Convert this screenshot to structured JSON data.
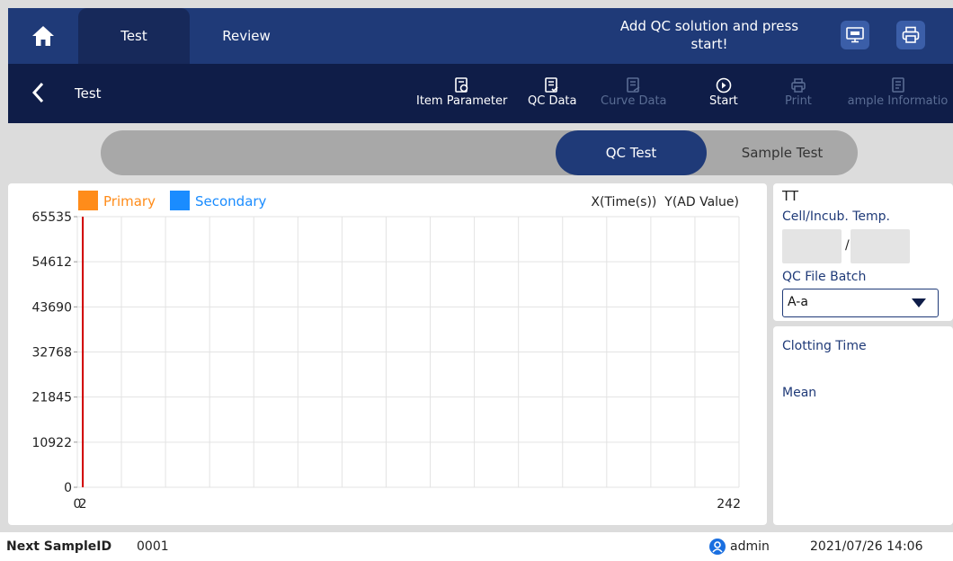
{
  "header": {
    "tabs": [
      {
        "label": "Test"
      },
      {
        "label": "Review"
      }
    ],
    "message": "Add QC solution and press start!"
  },
  "subheader": {
    "title": "Test",
    "tools": [
      {
        "label": "Item Parameter"
      },
      {
        "label": "QC Data"
      },
      {
        "label": "Curve Data"
      },
      {
        "label": "Start"
      },
      {
        "label": "Print"
      },
      {
        "label": "ample Informatio"
      }
    ]
  },
  "segment": {
    "qc_label": "QC Test",
    "sample_label": "Sample Test"
  },
  "chart_data": {
    "type": "line",
    "legend": [
      {
        "name": "Primary",
        "color": "#ff8c1a"
      },
      {
        "name": "Secondary",
        "color": "#1a8cff"
      }
    ],
    "axis_title": "X(Time(s))  Y(AD Value)",
    "yticks": [
      "65535",
      "54612",
      "43690",
      "32768",
      "21845",
      "10922",
      "0"
    ],
    "xticks": [
      "0",
      "2",
      "242"
    ],
    "xlim": [
      0,
      242
    ],
    "ylim": [
      0,
      65535
    ],
    "series": [
      {
        "name": "Primary",
        "color": "#d00000",
        "points": [
          [
            2,
            0
          ],
          [
            2,
            65535
          ]
        ]
      }
    ],
    "grid": true
  },
  "side": {
    "item_name": "TT",
    "temp_label": "Cell/Incub. Temp.",
    "temp_sep": "/",
    "batch_label": "QC File Batch",
    "batch_value": "A-a",
    "clotting_label": "Clotting Time",
    "mean_label": "Mean"
  },
  "status": {
    "next_label": "Next SampleID",
    "next_value": "0001",
    "user": "admin",
    "datetime": "2021/07/26 14:06"
  }
}
